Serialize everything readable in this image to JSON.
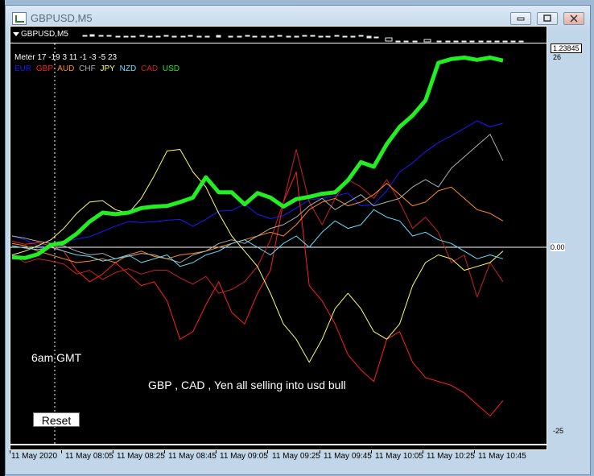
{
  "window": {
    "title": "GBPUSD,M5"
  },
  "chart": {
    "symbol_label": "GBPUSD,M5",
    "meter_text": "Meter 17 -19 3 11 -1 -3 -5 23",
    "legend": [
      {
        "label": "EUR",
        "color": "#1a1aff"
      },
      {
        "label": "GBP",
        "color": "#ff2020"
      },
      {
        "label": "AUD",
        "color": "#ff8c1a"
      },
      {
        "label": "CHF",
        "color": "#b0b0b0"
      },
      {
        "label": "JPY",
        "color": "#ffff66"
      },
      {
        "label": "NZD",
        "color": "#66e0ff"
      },
      {
        "label": "CAD",
        "color": "#cc2222"
      },
      {
        "label": "USD",
        "color": "#22ee22"
      }
    ],
    "annotations": {
      "session": "6am GMT",
      "note": "GBP , CAD , Yen all selling into usd bull"
    },
    "reset_button": "Reset"
  },
  "price_scale": {
    "current_price": "1.23845",
    "top": "26",
    "zero": "0.00",
    "bottom": "-25"
  },
  "time_axis": [
    "11 May 2020",
    "11 May 08:05",
    "11 May 08:25",
    "11 May 08:45",
    "11 May 09:05",
    "11 May 09:25",
    "11 May 09:45",
    "11 May 10:05",
    "11 May 10:25",
    "11 May 10:45"
  ],
  "chart_data": {
    "type": "line",
    "x": [
      "07:45",
      "07:50",
      "07:55",
      "08:00",
      "08:05",
      "08:10",
      "08:15",
      "08:20",
      "08:25",
      "08:30",
      "08:35",
      "08:40",
      "08:45",
      "08:50",
      "08:55",
      "09:00",
      "09:05",
      "09:10",
      "09:15",
      "09:20",
      "09:25",
      "09:30",
      "09:35",
      "09:40",
      "09:45",
      "09:50",
      "09:55",
      "10:00",
      "10:05",
      "10:10",
      "10:15",
      "10:20",
      "10:25",
      "10:30",
      "10:35",
      "10:40",
      "10:45",
      "10:50",
      "10:55"
    ],
    "ylim": [
      -25,
      26
    ],
    "series": [
      {
        "name": "USD",
        "color": "#22ee22",
        "values": [
          -1.3,
          -1.4,
          -0.9,
          0.3,
          0.6,
          1.8,
          3.4,
          4.6,
          4.4,
          4.6,
          5.2,
          5.4,
          5.5,
          6.0,
          6.6,
          9.3,
          7.3,
          7.3,
          5.7,
          7.2,
          6.6,
          5.4,
          6.4,
          6.7,
          7.1,
          7.3,
          8.9,
          11.3,
          10.7,
          13.7,
          16.0,
          17.5,
          19.5,
          24.5,
          25.0,
          25.2,
          24.9,
          25.2,
          24.8
        ]
      },
      {
        "name": "EUR",
        "color": "#1a1aff",
        "values": [
          1.5,
          1.0,
          0.2,
          0.1,
          0.7,
          1.1,
          1.4,
          2.1,
          2.8,
          3.4,
          3.3,
          3.4,
          3.6,
          3.7,
          2.8,
          3.7,
          4.8,
          4.9,
          5.7,
          4.4,
          3.8,
          4.2,
          5.2,
          6.3,
          6.5,
          6.8,
          7.2,
          5.5,
          5.7,
          7.5,
          10.0,
          11.2,
          12.7,
          13.9,
          14.8,
          15.8,
          16.8,
          16.0,
          16.5
        ]
      },
      {
        "name": "GBP",
        "color": "#ff2020",
        "values": [
          0.8,
          0.4,
          0.6,
          0.2,
          -0.5,
          -3.0,
          -4.5,
          -3.5,
          -2.0,
          -3.5,
          -5.0,
          -4.5,
          -7.0,
          -12.0,
          -11.0,
          -7.5,
          -4.5,
          -8.5,
          -10.0,
          -6.0,
          -3.0,
          6.0,
          10.0,
          -5.0,
          -7.0,
          -10.0,
          -14.0,
          -16.0,
          -17.5,
          -12.0,
          -11.0,
          -15.0,
          -17.0,
          -17.5,
          -18.0,
          -19.0,
          -20.5,
          -22.0,
          -20.0
        ]
      },
      {
        "name": "CAD",
        "color": "#cc2222",
        "values": [
          -1.0,
          -2.0,
          -1.5,
          -1.8,
          -2.2,
          -3.5,
          -3.0,
          -4.2,
          -3.3,
          -2.8,
          -3.5,
          -3.0,
          -3.0,
          -4.0,
          -4.8,
          -3.8,
          -6.0,
          -5.5,
          -4.5,
          -2.5,
          1.0,
          6.0,
          13.0,
          6.0,
          3.0,
          6.5,
          9.0,
          8.0,
          6.5,
          9.0,
          6.0,
          2.5,
          4.0,
          2.0,
          -2.0,
          -1.0,
          -6.5,
          -2.0,
          -4.5
        ]
      },
      {
        "name": "JPY",
        "color": "#ffff66",
        "values": [
          -1.0,
          -0.5,
          0.2,
          1.0,
          2.5,
          4.5,
          6.0,
          6.2,
          5.0,
          4.5,
          6.5,
          9.5,
          12.8,
          13.0,
          10.0,
          8.0,
          4.5,
          1.5,
          -0.5,
          -2.5,
          -6.0,
          -10.0,
          -12.0,
          -15.0,
          -12.0,
          -8.0,
          -6.0,
          -8.0,
          -11.0,
          -12.0,
          -10.0,
          -5.0,
          -2.0,
          -1.0,
          -1.5,
          -3.0,
          -2.5,
          -2.0,
          -0.5
        ]
      },
      {
        "name": "AUD",
        "color": "#ff8c1a",
        "values": [
          0.5,
          0.2,
          -0.5,
          -1.0,
          -1.5,
          -2.0,
          -1.8,
          -1.5,
          -2.0,
          -1.0,
          -0.5,
          -1.2,
          -1.5,
          -1.0,
          -0.8,
          -0.5,
          0.0,
          0.5,
          1.0,
          1.5,
          2.0,
          1.5,
          3.0,
          5.0,
          6.0,
          6.5,
          5.5,
          6.0,
          7.0,
          8.5,
          7.0,
          5.5,
          6.0,
          7.5,
          8.0,
          6.5,
          5.0,
          4.5,
          3.5
        ]
      },
      {
        "name": "CHF",
        "color": "#b0b0b0",
        "values": [
          1.5,
          1.2,
          0.8,
          0.5,
          0.2,
          -0.5,
          -1.0,
          -0.8,
          -1.5,
          -1.2,
          -0.8,
          -1.0,
          -1.5,
          -2.0,
          -1.0,
          -0.5,
          0.5,
          1.0,
          0.5,
          1.5,
          2.5,
          3.0,
          4.0,
          5.5,
          6.5,
          5.0,
          6.0,
          7.0,
          5.5,
          6.0,
          6.5,
          8.0,
          9.0,
          8.0,
          10.5,
          12.0,
          13.5,
          15.0,
          11.5
        ]
      },
      {
        "name": "NZD",
        "color": "#66e0ff",
        "values": [
          0.2,
          -0.1,
          -0.3,
          0.0,
          -0.5,
          -1.0,
          -1.2,
          -1.8,
          -1.5,
          -1.0,
          -2.0,
          -1.5,
          -1.0,
          -2.5,
          -2.0,
          -1.0,
          -0.5,
          0.5,
          1.0,
          0.0,
          -1.0,
          0.5,
          1.5,
          0.0,
          2.0,
          3.5,
          2.5,
          3.0,
          5.0,
          4.0,
          3.5,
          1.5,
          2.0,
          1.0,
          0.5,
          -0.5,
          -1.5,
          -1.0,
          -1.5
        ]
      }
    ]
  }
}
